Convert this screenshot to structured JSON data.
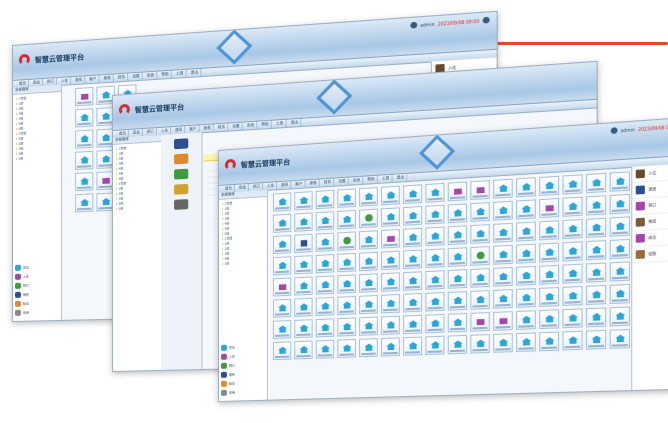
{
  "brand": {
    "title": "智慧云管理平台",
    "accent_color": "#e8462b",
    "logo_color": "#d42c2c"
  },
  "header": {
    "user_label": "admin",
    "status_text": "2023/09/08 09:00",
    "power_icon": "power-icon"
  },
  "nav_items": [
    "首页",
    "房态",
    "预订",
    "入住",
    "退房",
    "客户",
    "报表",
    "财务",
    "设置",
    "系统",
    "帮助",
    "工具",
    "退出"
  ],
  "tree_items": [
    "全部楼栋",
    "1号楼",
    "1层",
    "2层",
    "3层",
    "4层",
    "5层",
    "6层",
    "2号楼",
    "1层",
    "2层",
    "3层",
    "4层",
    "5层"
  ],
  "legend": [
    {
      "label": "空房",
      "color": "#2ba6d7"
    },
    {
      "label": "入住",
      "color": "#a347a8"
    },
    {
      "label": "预订",
      "color": "#3f9b3d"
    },
    {
      "label": "维修",
      "color": "#2c4f91"
    },
    {
      "label": "脏房",
      "color": "#e08a2a"
    },
    {
      "label": "停用",
      "color": "#888888"
    }
  ],
  "right_panel": [
    {
      "label": "入住",
      "color": "#6b4a2a"
    },
    {
      "label": "退房",
      "color": "#2c4f91"
    },
    {
      "label": "预订",
      "color": "#a347a8"
    },
    {
      "label": "换房",
      "color": "#7a5a3a"
    },
    {
      "label": "续住",
      "color": "#a347a8"
    },
    {
      "label": "结账",
      "color": "#9a6a3a"
    }
  ],
  "room_layout_w3": "bbbbbbbbppbbbbbb|bbbbgbbbbbbbpbbb|bnbgbpbbbbbbbbbb|bbbbbbbbbgbbbbbb|pbbbbbbbbbbbbbbb|bbbbbbbbbbbbbbbb|bbbbbbbbbppbbbbb|bbbbbbbbbbbbbbbb",
  "room_layout_w1": "pbb|bbb|bbg|bbb|bpb|bbb",
  "mid_icons": [
    "#2c4f91",
    "#e08a2a",
    "#3f9b3d",
    "#d4a030",
    "#666666"
  ]
}
